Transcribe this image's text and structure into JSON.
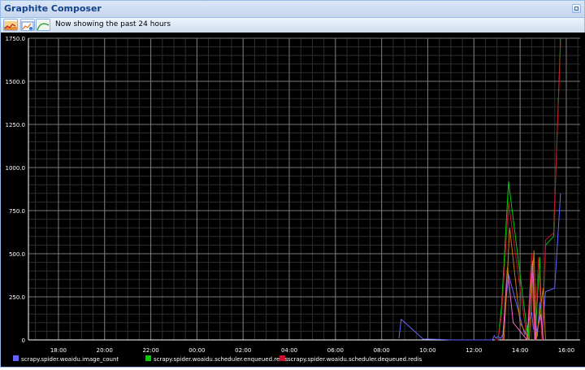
{
  "window": {
    "title": "Graphite Composer"
  },
  "toolbar": {
    "status": "Now showing the past 24 hours",
    "buttons": [
      {
        "name": "graph-data-button",
        "icon": "graph-data-icon"
      },
      {
        "name": "render-options-button",
        "icon": "chart-options-icon"
      },
      {
        "name": "time-range-button",
        "icon": "time-range-icon"
      }
    ]
  },
  "chart_data": {
    "type": "line",
    "title": "",
    "xlabel": "",
    "ylabel": "",
    "background": "#000000",
    "grid": true,
    "legend_placement": "bottom",
    "ylim": [
      0,
      1750
    ],
    "y_ticks": [
      0,
      250,
      500,
      750,
      1000,
      1250,
      1500,
      1750
    ],
    "y_tick_labels": [
      "0",
      "250.0",
      "500.0",
      "750.0",
      "1000.0",
      "1250.0",
      "1500.0",
      "1750.0"
    ],
    "x_range_hours": [
      16.7,
      40.6
    ],
    "x_ticks_hours": [
      18,
      20,
      22,
      24,
      26,
      28,
      30,
      32,
      34,
      36,
      38,
      40
    ],
    "x_tick_labels": [
      "18:00",
      "20:00",
      "22:00",
      "00:00",
      "02:00",
      "04:00",
      "06:00",
      "08:00",
      "10:00",
      "12:00",
      "14:00",
      "16:00"
    ],
    "series": [
      {
        "name": "scrapy.spider.woaidu.image_count",
        "color": "#6464ff",
        "points": [
          [
            32.75,
            10
          ],
          [
            32.85,
            120
          ],
          [
            33.8,
            5
          ],
          [
            34.5,
            3
          ],
          [
            35.0,
            0
          ],
          [
            36.0,
            0
          ],
          [
            36.8,
            0
          ],
          [
            36.88,
            25
          ],
          [
            36.95,
            10
          ],
          [
            37.05,
            20
          ],
          [
            37.15,
            8
          ],
          [
            37.25,
            30
          ],
          [
            37.5,
            380
          ],
          [
            38.2,
            30
          ],
          [
            38.5,
            160
          ],
          [
            38.58,
            60
          ],
          [
            38.65,
            150
          ],
          [
            38.75,
            20
          ],
          [
            38.85,
            220
          ],
          [
            38.95,
            10
          ],
          [
            39.1,
            280
          ],
          [
            39.5,
            300
          ],
          [
            39.75,
            850
          ]
        ]
      },
      {
        "name": "scrapy.spider.woaidu.scheduler.enqueued.redis",
        "color": "#00cc00",
        "points": [
          [
            36.9,
            0
          ],
          [
            37.05,
            0
          ],
          [
            37.2,
            200
          ],
          [
            37.5,
            920
          ],
          [
            38.35,
            0
          ],
          [
            38.5,
            480
          ],
          [
            38.65,
            0
          ],
          [
            38.85,
            480
          ],
          [
            38.95,
            0
          ],
          [
            39.1,
            550
          ],
          [
            39.45,
            600
          ],
          [
            39.75,
            1780
          ]
        ]
      },
      {
        "name": "scrapy.spider.woaidu.scheduler.dequeued.redis",
        "color": "#c8102e",
        "points": [
          [
            36.9,
            0
          ],
          [
            37.05,
            0
          ],
          [
            37.2,
            150
          ],
          [
            37.5,
            800
          ],
          [
            38.3,
            0
          ],
          [
            38.5,
            500
          ],
          [
            38.62,
            0
          ],
          [
            38.8,
            480
          ],
          [
            38.95,
            0
          ],
          [
            39.1,
            580
          ],
          [
            39.45,
            620
          ],
          [
            39.75,
            1720
          ]
        ]
      },
      {
        "name": "",
        "color": "#ff66cc",
        "points": [
          [
            37.25,
            0
          ],
          [
            37.45,
            420
          ],
          [
            37.7,
            100
          ],
          [
            38.3,
            0
          ],
          [
            38.55,
            460
          ],
          [
            38.65,
            0
          ],
          [
            38.9,
            150
          ],
          [
            39.0,
            0
          ]
        ]
      },
      {
        "name": "",
        "color": "#c87800",
        "points": [
          [
            37.3,
            0
          ],
          [
            37.55,
            650
          ],
          [
            38.0,
            100
          ],
          [
            38.4,
            0
          ],
          [
            38.6,
            520
          ],
          [
            38.7,
            0
          ],
          [
            39.0,
            300
          ],
          [
            39.1,
            0
          ]
        ]
      }
    ]
  }
}
